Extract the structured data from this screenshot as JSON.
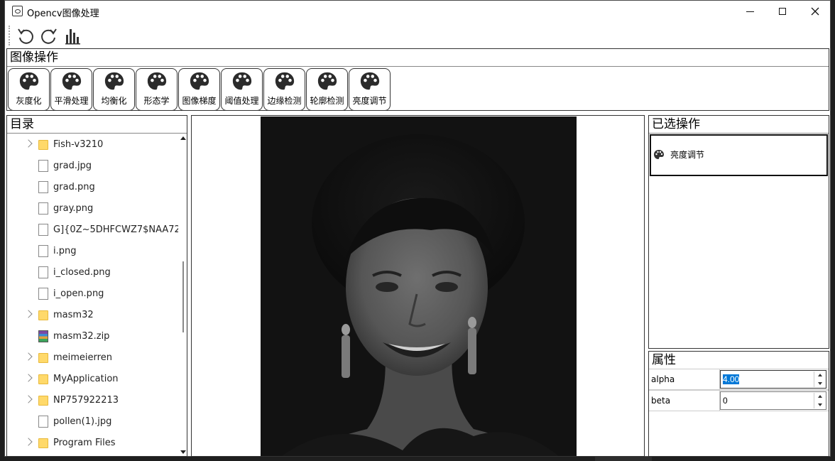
{
  "window": {
    "title": "Opencv图像处理"
  },
  "toolbar": {
    "icons": [
      "undo-icon",
      "redo-icon",
      "histogram-icon"
    ]
  },
  "ops": {
    "header": "图像操作",
    "buttons": [
      {
        "label": "灰度化"
      },
      {
        "label": "平滑处理"
      },
      {
        "label": "均衡化"
      },
      {
        "label": "形态学"
      },
      {
        "label": "图像梯度"
      },
      {
        "label": "阈值处理"
      },
      {
        "label": "边缘检测"
      },
      {
        "label": "轮廓检测"
      },
      {
        "label": "亮度调节"
      }
    ]
  },
  "directory": {
    "header": "目录",
    "items": [
      {
        "name": "Fish-v3210",
        "type": "folder",
        "expandable": true
      },
      {
        "name": "grad.jpg",
        "type": "file",
        "expandable": false
      },
      {
        "name": "grad.png",
        "type": "file",
        "expandable": false
      },
      {
        "name": "gray.png",
        "type": "file",
        "expandable": false
      },
      {
        "name": "G]{0Z~5DHFCWZ7$NAA72...",
        "type": "file",
        "expandable": false
      },
      {
        "name": "i.png",
        "type": "file",
        "expandable": false
      },
      {
        "name": "i_closed.png",
        "type": "file",
        "expandable": false
      },
      {
        "name": "i_open.png",
        "type": "file",
        "expandable": false
      },
      {
        "name": "masm32",
        "type": "folder",
        "expandable": true
      },
      {
        "name": "masm32.zip",
        "type": "zip",
        "expandable": false
      },
      {
        "name": "meimeierren",
        "type": "folder",
        "expandable": true
      },
      {
        "name": "MyApplication",
        "type": "folder",
        "expandable": true
      },
      {
        "name": "NP757922213",
        "type": "folder",
        "expandable": true
      },
      {
        "name": "pollen(1).jpg",
        "type": "file",
        "expandable": false
      },
      {
        "name": "Program Files",
        "type": "folder",
        "expandable": true
      }
    ]
  },
  "selected": {
    "header": "已选操作",
    "items": [
      {
        "label": "亮度调节"
      }
    ]
  },
  "properties": {
    "header": "属性",
    "rows": [
      {
        "name": "alpha",
        "value": "4.00"
      },
      {
        "name": "beta",
        "value": "0"
      }
    ]
  }
}
